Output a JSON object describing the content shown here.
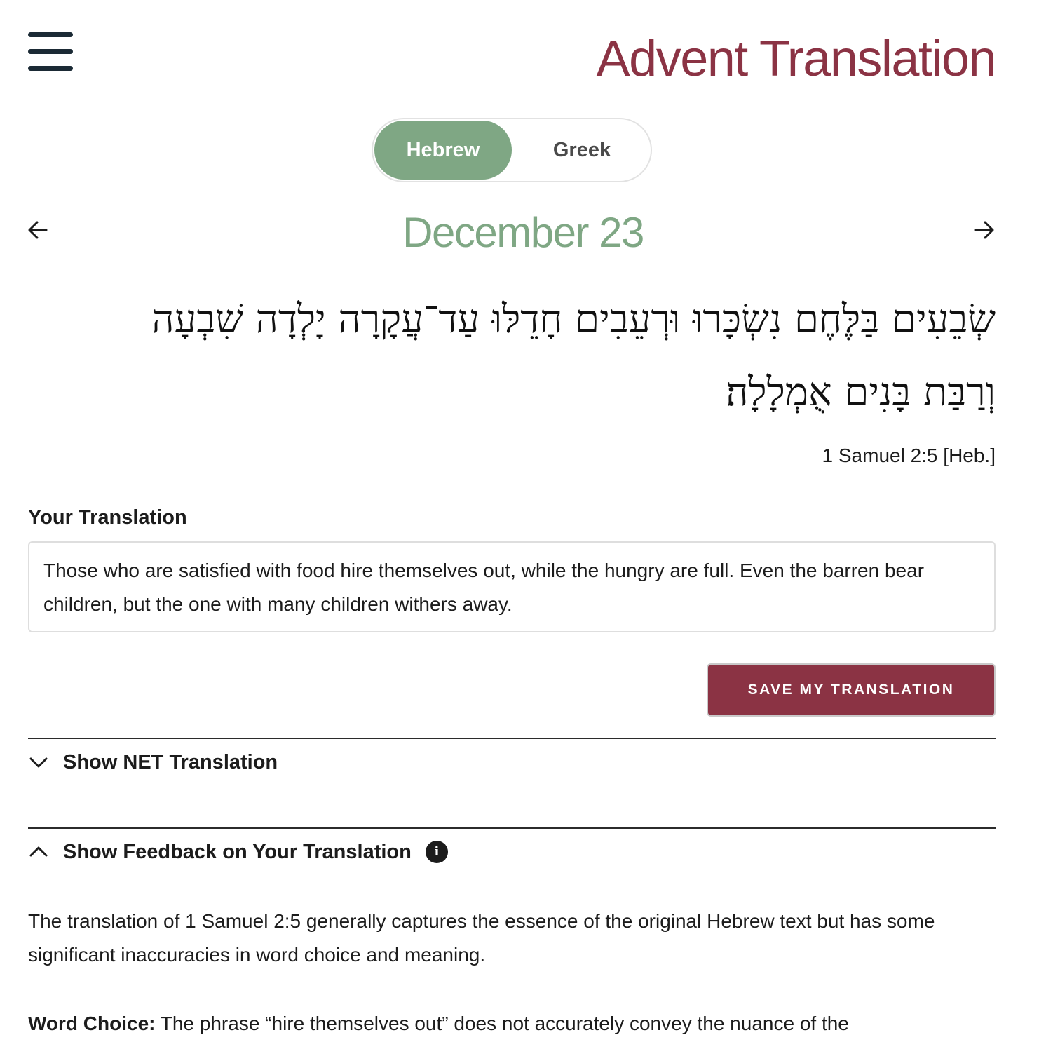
{
  "header": {
    "title": "Advent Translation"
  },
  "language_toggle": {
    "options": [
      "Hebrew",
      "Greek"
    ],
    "selected": "Hebrew"
  },
  "date_nav": {
    "date": "December 23"
  },
  "verse": {
    "hebrew_line1": "שְׂבֵעִים בַּלֶּחֶם נִשְׂכָּרוּ וּרְעֵבִים חָדֵלּוּ עַד־עֲקָרָה יָלְדָה שִׁבְעָה",
    "hebrew_line2": "וְרַבַּת בָּנִים אֻמְלָלָה׃",
    "reference": "1 Samuel 2:5 [Heb.]"
  },
  "translation": {
    "label": "Your Translation",
    "value": "Those who are satisfied with food hire themselves out, while the hungry are full. Even the barren bear children, but the one with many children withers away.",
    "save_label": "SAVE MY TRANSLATION"
  },
  "accordions": {
    "net_label": "Show NET Translation",
    "feedback_label": "Show Feedback on Your Translation"
  },
  "feedback": {
    "paragraph1": "The translation of 1 Samuel 2:5 generally captures the essence of the original Hebrew text but has some significant inaccuracies in word choice and meaning.",
    "word_choice_heading": "Word Choice:",
    "word_choice_text": " The phrase “hire themselves out” does not accurately convey the nuance of the"
  },
  "colors": {
    "brand": "#8b3344",
    "accent_green": "#7fa784",
    "text": "#1c1c1c"
  },
  "icons": {
    "menu": "hamburger-icon",
    "prev": "arrow-left-icon",
    "next": "arrow-right-icon",
    "net_chevron": "chevron-down-icon",
    "feedback_chevron": "chevron-up-icon",
    "info": "info-icon"
  }
}
